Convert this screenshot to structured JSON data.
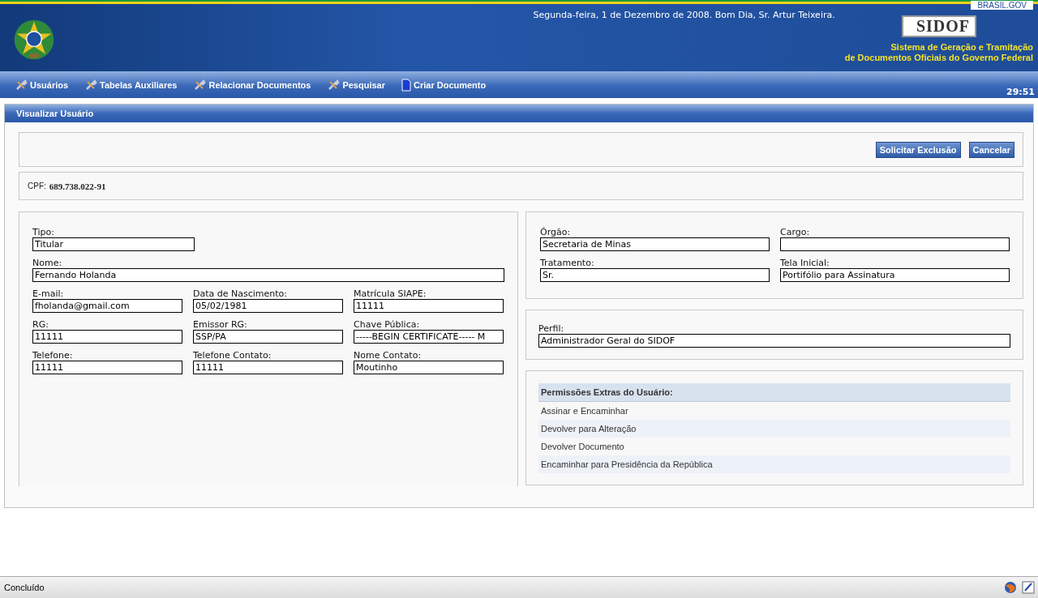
{
  "header": {
    "greeting": "Segunda-feira, 1 de Dezembro de 2008. Bom Dia, Sr. Artur Teixeira.",
    "portal_link": "BRASIL.GOV",
    "logo_text": "SIDOF",
    "system_name": [
      "Sistema de Geração e Tramitação",
      "de Documentos  Oficiais do Governo Federal"
    ]
  },
  "menu": [
    {
      "label": "Usuários",
      "kind": "wrench"
    },
    {
      "label": "Tabelas Auxiliares",
      "kind": "wrench"
    },
    {
      "label": "Relacionar Documentos",
      "kind": "wrench"
    },
    {
      "label": "Pesquisar",
      "kind": "wrench"
    },
    {
      "label": "Criar Documento",
      "kind": "document"
    }
  ],
  "session_timer": "29:51",
  "page_title": "Visualizar Usuário",
  "actions": [
    "Solicitar Exclusão",
    "Cancelar"
  ],
  "cpf": {
    "label": "CPF:",
    "value": "689.738.022-91"
  },
  "personal": [
    [
      {
        "label": "Tipo:",
        "value": "Titular",
        "kind": "short"
      }
    ],
    [
      {
        "label": "Nome:",
        "value": "Fernando Holanda",
        "kind": "full"
      }
    ],
    [
      {
        "label": "E-mail:",
        "value": "fholanda@gmail.com",
        "kind": "third"
      },
      {
        "label": "Data de Nascimento:",
        "value": "05/02/1981",
        "kind": "third"
      },
      {
        "label": "Matrícula SIAPE:",
        "value": "11111",
        "kind": "third"
      }
    ],
    [
      {
        "label": "RG:",
        "value": "11111",
        "kind": "third"
      },
      {
        "label": "Emissor RG:",
        "value": "SSP/PA",
        "kind": "third"
      },
      {
        "label": "Chave Pública:",
        "value": "-----BEGIN CERTIFICATE----- M",
        "kind": "third"
      }
    ],
    [
      {
        "label": "Telefone:",
        "value": "11111",
        "kind": "third"
      },
      {
        "label": "Telefone Contato:",
        "value": "11111",
        "kind": "third"
      },
      {
        "label": "Nome Contato:",
        "value": "Moutinho",
        "kind": "third"
      }
    ]
  ],
  "organization": [
    {
      "label": "Órgão:",
      "value": "Secretaria de Minas"
    },
    {
      "label": "Cargo:"
    },
    {
      "label": "Tratamento:",
      "value": "Sr."
    },
    {
      "label": "Tela Inicial:",
      "value": "Portifólio para Assinatura"
    }
  ],
  "profile": {
    "label": "Perfil:",
    "value": "Administrador Geral do SIDOF"
  },
  "permissions": {
    "title": "Permissões Extras do Usuário:",
    "items": [
      "Assinar e Encaminhar",
      "Devolver para Alteração",
      "Devolver Documento",
      "Encaminhar para Presidência da República"
    ]
  },
  "status_bar": {
    "text": "Concluído"
  }
}
